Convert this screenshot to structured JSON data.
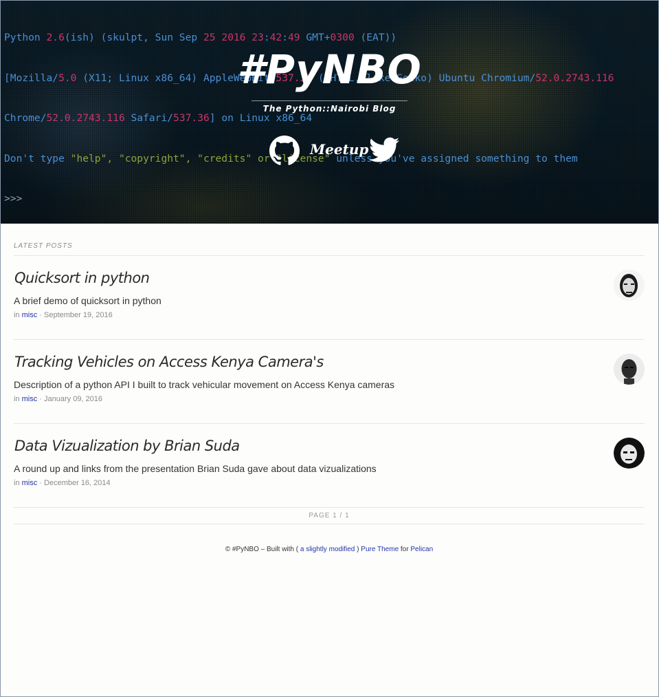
{
  "terminal": {
    "line1": {
      "a": "Python ",
      "b": "2.6",
      "c": "(ish) (skulpt, Sun Sep ",
      "d": "25 2016 23",
      "e": ":",
      "f": "42",
      "g": ":",
      "h": "49",
      "i": " GMT+",
      "j": "0300",
      "k": " (EAT))"
    },
    "line2": {
      "a": "[Mozilla/",
      "b": "5.0",
      "c": " (X11; Linux x86_64) AppleWebKit/",
      "d": "537.36",
      "e": " (KHTML, like Gecko) Ubuntu Chromium/",
      "f": "52.0.2743.116"
    },
    "line3": {
      "a": "Chrome/",
      "b": "52.0.2743.116",
      "c": " Safari/",
      "d": "537.36",
      "e": "] on Linux x86_64"
    },
    "line4": {
      "a": "Don't type ",
      "b": "\"help\", \"copyright\", \"credits\" or \"license\"",
      "c": " unless you've assigned something to them"
    },
    "prompt": ">>>"
  },
  "site": {
    "title": "#PyNBO",
    "subtitle": "The Python::Nairobi Blog",
    "meetup": "Meetup"
  },
  "section_label": "LATEST POSTS",
  "posts": [
    {
      "title": "Quicksort in python",
      "description": "A brief demo of quicksort in python",
      "in": "in",
      "category": "misc",
      "date": "September 19, 2016"
    },
    {
      "title": "Tracking Vehicles on Access Kenya Camera's",
      "description": "Description of a python API I built to track vehicular movement on Access Kenya cameras",
      "in": "in",
      "category": "misc",
      "date": "January 09, 2016"
    },
    {
      "title": "Data Vizualization by Brian Suda",
      "description": "A round up and links from the presentation Brian Suda gave about data vizualizations",
      "in": "in",
      "category": "misc",
      "date": "December 16, 2014"
    }
  ],
  "pager": "PAGE 1 / 1",
  "footer": {
    "copy": "© #PyNBO – Built with (",
    "modified": "a slightly modified",
    "close": ")",
    "theme": "Pure Theme",
    "for": "for",
    "pelican": "Pelican"
  },
  "colors": {
    "hero_bg": "#0c1e29",
    "link": "#2233aa",
    "terminal_blue": "#4a8fd3",
    "terminal_pink": "#c8366a",
    "terminal_green": "#8ea33a"
  },
  "icons": [
    "github-icon",
    "twitter-icon",
    "avatar"
  ]
}
